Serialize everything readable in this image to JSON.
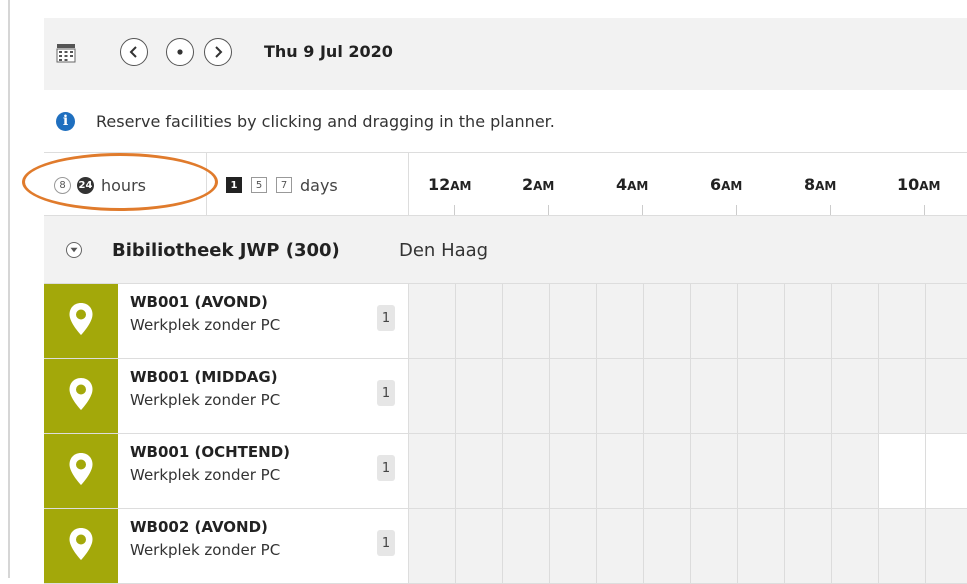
{
  "toolbar": {
    "calendar_icon": "calendar-grid-icon",
    "prev_icon": "chevron-left-icon",
    "today_icon": "dot-icon",
    "next_icon": "chevron-right-icon",
    "date": "Thu 9 Jul 2020"
  },
  "info": {
    "icon": "info-icon",
    "icon_glyph": "i",
    "text": "Reserve facilities by clicking and dragging in the planner."
  },
  "view_switch": {
    "hour_options": [
      "8",
      "24"
    ],
    "selected_hours": "24",
    "hours_label": "hours",
    "day_options": [
      "1",
      "5",
      "7"
    ],
    "selected_days": "1",
    "days_label": "days"
  },
  "timeline": {
    "labels": [
      {
        "num": "12",
        "suffix": "AM"
      },
      {
        "num": "2",
        "suffix": "AM"
      },
      {
        "num": "4",
        "suffix": "AM"
      },
      {
        "num": "6",
        "suffix": "AM"
      },
      {
        "num": "8",
        "suffix": "AM"
      },
      {
        "num": "10",
        "suffix": "AM"
      }
    ]
  },
  "group": {
    "name": "Bibiliotheek JWP (300)",
    "city": "Den Haag",
    "toggle_icon": "collapse-arrow-icon"
  },
  "resources": [
    {
      "name": "WB001 (AVOND)",
      "type": "Werkplek zonder PC",
      "capacity": "1",
      "icon": "location-pin-icon",
      "free_slots_from_10am": 0
    },
    {
      "name": "WB001 (MIDDAG)",
      "type": "Werkplek zonder PC",
      "capacity": "1",
      "icon": "location-pin-icon",
      "free_slots_from_10am": 0
    },
    {
      "name": "WB001 (OCHTEND)",
      "type": "Werkplek zonder PC",
      "capacity": "1",
      "icon": "location-pin-icon",
      "free_slots_from_10am": 2
    },
    {
      "name": "WB002 (AVOND)",
      "type": "Werkplek zonder PC",
      "capacity": "1",
      "icon": "location-pin-icon",
      "free_slots_from_10am": 0
    }
  ],
  "colors": {
    "marker": "#a3a80a",
    "highlight_ring": "#e07b2c",
    "info": "#1f6fbf",
    "unavailable": "#f2f2f2",
    "available": "#ffffff"
  }
}
